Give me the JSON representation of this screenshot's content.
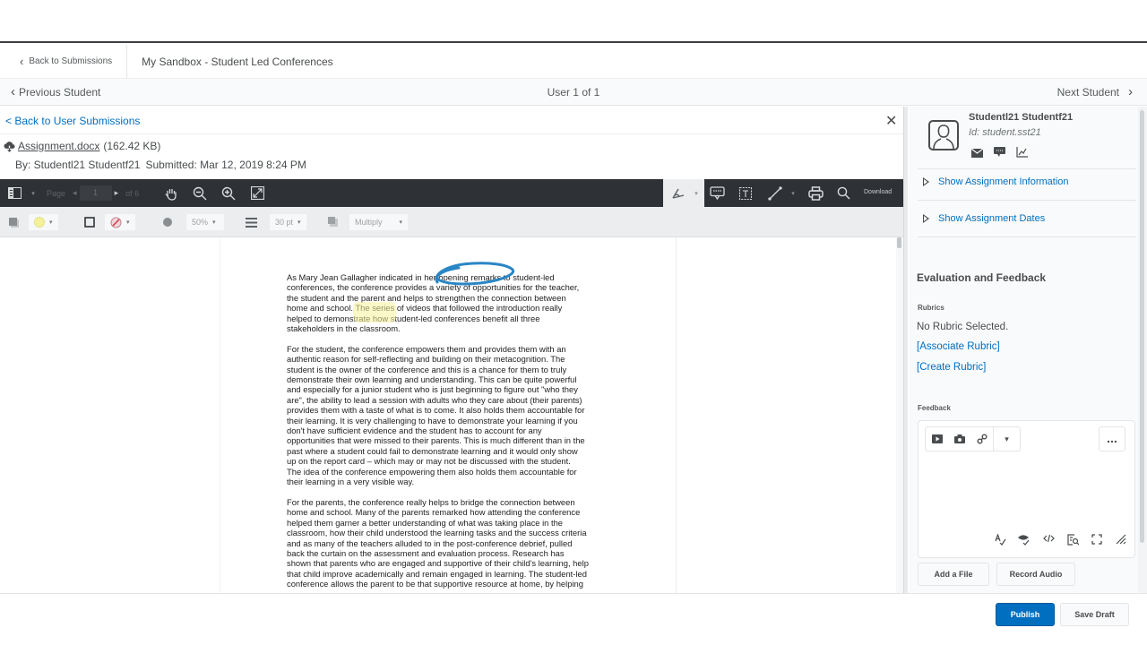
{
  "breadcrumb": {
    "back_label": "Back to Submissions",
    "title": "My Sandbox - Student Led Conferences"
  },
  "student_nav": {
    "prev_label": "Previous Student",
    "position": "User 1 of 1",
    "next_label": "Next Student"
  },
  "submission": {
    "back_label": "< Back to User Submissions",
    "file_name": "Assignment.docx",
    "file_size": "(162.42 KB)",
    "by_label": "By: Studentl21 Studentf21",
    "submitted_label": "Submitted: Mar 12, 2019 8:24 PM"
  },
  "viewer_toolbar": {
    "page_label": "Page",
    "page_value": "1",
    "page_total": "of 6",
    "download_label": "Download",
    "icons": [
      "sidebar-toggle-icon",
      "pan-hand-icon",
      "zoom-out-icon",
      "zoom-in-icon",
      "fullscreen-icon",
      "pen-annotation-icon",
      "comment-icon",
      "text-box-icon",
      "line-icon",
      "print-icon",
      "search-icon"
    ]
  },
  "annotation_toolbar": {
    "fill_color": "#f3f19a",
    "opacity": "50%",
    "stroke_size": "30 pt",
    "blend_mode": "Multiply"
  },
  "document": {
    "paragraphs": [
      "As Mary Jean Gallagher indicated in her opening remarks to student-led\nconferences, the conference provides a variety of opportunities for the teacher,\nthe student and the parent and helps to strengthen the connection between\nhome and school. The series of videos that followed the introduction really\nhelped to demonstrate how student-led conferences benefit all three\nstakeholders in the classroom.",
      "For the student, the conference empowers them and provides them with an\nauthentic reason for self-reflecting and building on their metacognition.  The\nstudent is the owner of the conference and this is a chance for them to truly\ndemonstrate their own learning and understanding. This can be quite powerful\nand especially for a junior student who is just beginning to figure out \"who they\nare\", the ability to lead a session with adults who they care about (their parents)\nprovides them with a taste of what is to come.  It also holds them accountable for\ntheir learning.  It is very challenging to have to demonstrate your learning if you\ndon't have sufficient evidence and the student has to account for any\nopportunities that were missed to their parents.  This is much different than in the\npast where a student could fail to demonstrate learning and it would only show\nup on the report card – which may or may not be discussed with the student.\nThe idea of the conference empowering them also holds them accountable for\ntheir learning in a very visible way.",
      "For the parents, the conference really helps to bridge the connection between\nhome and school.  Many of the parents remarked how attending the conference\nhelped them garner a better understanding of what was taking place in the\nclassroom, how their child understood the learning tasks and the success criteria\nand as many of the teachers alluded to in the post-conference debrief, pulled\nback the curtain on the assessment and evaluation process. Research has\nshown that parents who are engaged and supportive of their child's learning, help\nthat child improve academically and remain engaged in learning. The student-led\nconference allows the parent to be that supportive resource at home, by helping"
    ],
    "ink_color": "#2a86c5",
    "highlight_color": "#f7f29a"
  },
  "student_card": {
    "name": "Studentl21 Studentf21",
    "id_label": "Id: student.sst21"
  },
  "side_panel": {
    "show_info": "Show Assignment Information",
    "show_dates": "Show Assignment Dates",
    "eval_heading": "Evaluation and Feedback",
    "rubrics_label": "Rubrics",
    "no_rubric": "No Rubric Selected.",
    "associate_rubric": "[Associate Rubric]",
    "create_rubric": "[Create Rubric]",
    "feedback_label": "Feedback",
    "more_label": "...",
    "add_file": "Add a File",
    "record_audio": "Record Audio"
  },
  "footer": {
    "publish": "Publish",
    "save_draft": "Save Draft"
  },
  "colors": {
    "accent": "#006fbf",
    "toolbar_dark": "#2e3236"
  }
}
